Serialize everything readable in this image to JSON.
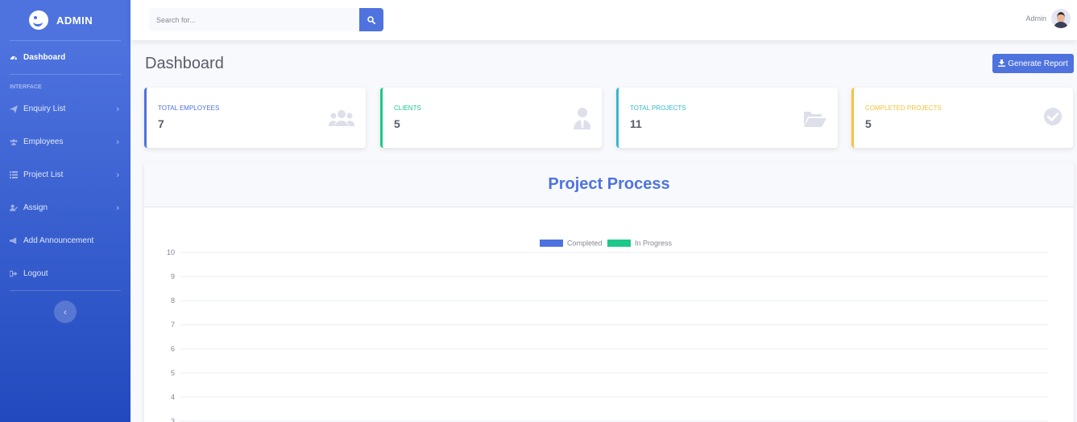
{
  "sidebar": {
    "brand": "ADMIN",
    "active_item": "Dashboard",
    "heading": "INTERFACE",
    "items": [
      {
        "label": "Enquiry List",
        "icon": "paper-plane-icon",
        "has_submenu": true
      },
      {
        "label": "Employees",
        "icon": "users-icon",
        "has_submenu": true
      },
      {
        "label": "Project List",
        "icon": "list-icon",
        "has_submenu": true
      },
      {
        "label": "Assign",
        "icon": "user-edit-icon",
        "has_submenu": true
      },
      {
        "label": "Add Announcement",
        "icon": "bullhorn-icon",
        "has_submenu": false
      },
      {
        "label": "Logout",
        "icon": "sign-out-icon",
        "has_submenu": false
      }
    ],
    "toggle_icon": "chevron-left-icon"
  },
  "topbar": {
    "search_placeholder": "Search for...",
    "user_name": "Admin"
  },
  "page": {
    "title": "Dashboard",
    "generate_report": "Generate Report"
  },
  "cards": [
    {
      "label": "TOTAL EMPLOYEES",
      "value": "7",
      "color": "#4e73df",
      "icon": "users-icon"
    },
    {
      "label": "CLIENTS",
      "value": "5",
      "color": "#1cc88a",
      "icon": "user-tie-icon"
    },
    {
      "label": "TOTAL PROJECTS",
      "value": "11",
      "color": "#36b9cc",
      "icon": "folder-open-icon"
    },
    {
      "label": "COMPLETED PROJECTS",
      "value": "5",
      "color": "#f6c23e",
      "icon": "check-circle-icon"
    }
  ],
  "chart_panel": {
    "title": "Project Process"
  },
  "chart_data": {
    "type": "bar",
    "title": "",
    "series": [
      {
        "name": "Completed",
        "color": "#4e73df"
      },
      {
        "name": "In Progress",
        "color": "#1cc88a"
      }
    ],
    "yticks": [
      "10",
      "9",
      "8",
      "7",
      "6",
      "5",
      "4",
      "3"
    ],
    "ylim": [
      0,
      10
    ],
    "grid": true,
    "legend": "top-center"
  }
}
